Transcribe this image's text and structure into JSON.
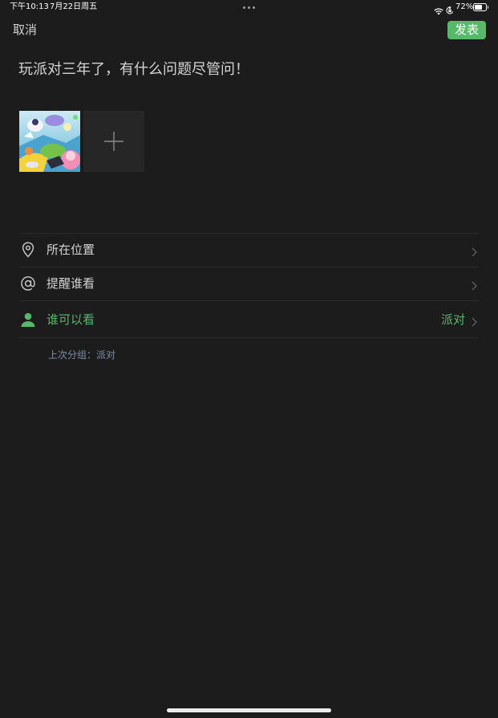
{
  "status_bar": {
    "time": "下午10:13",
    "date": "7月22日周五",
    "battery_percent": "72%",
    "battery_level": 0.72,
    "icons": [
      "multitasking-dots-icon",
      "wifi-icon",
      "orientation-lock-icon",
      "battery-icon"
    ]
  },
  "nav": {
    "cancel_label": "取消",
    "publish_label": "发表"
  },
  "composer": {
    "text": "玩派对三年了，有什么问题尽管问！",
    "add_photo_icon": "plus-icon"
  },
  "options": [
    {
      "icon": "location-pin-icon",
      "label": "所在位置"
    },
    {
      "icon": "at-icon",
      "label": "提醒谁看"
    },
    {
      "icon": "person-icon",
      "label": "谁可以看",
      "value": "派对"
    }
  ],
  "last_group_hint": "上次分组：派对",
  "colors": {
    "background": "#1c1c1c",
    "accent": "#57b86a",
    "hint": "#7d90a9",
    "divider": "#2b2b2b"
  }
}
